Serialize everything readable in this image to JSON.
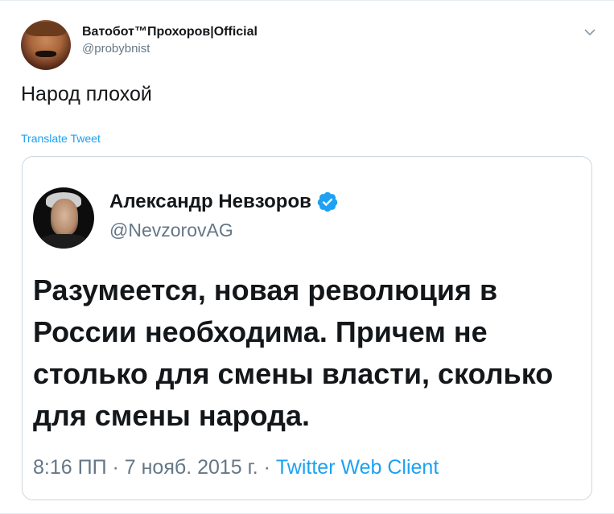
{
  "tweet": {
    "author": {
      "display_name": "Ватобот™Прохоров|Official",
      "handle": "@probybnist",
      "avatar": "user-avatar"
    },
    "menu_icon": "chevron-down-icon",
    "text": "Народ плохой",
    "translate_label": "Translate Tweet"
  },
  "quoted_tweet": {
    "author": {
      "display_name": "Александр Невзоров",
      "handle": "@NevzorovAG",
      "verified": true,
      "verified_icon": "verified-badge-icon"
    },
    "text": "Разумеется, новая революция в России необходима. Причем не столько для смены власти, сколько для смены народа.",
    "time": "8:16 ПП",
    "date": "7 нояб. 2015 г.",
    "separator": "·",
    "client": "Twitter Web Client"
  },
  "colors": {
    "accent": "#1da1f2",
    "secondary_text": "#657786",
    "border": "#ccd6dd"
  }
}
